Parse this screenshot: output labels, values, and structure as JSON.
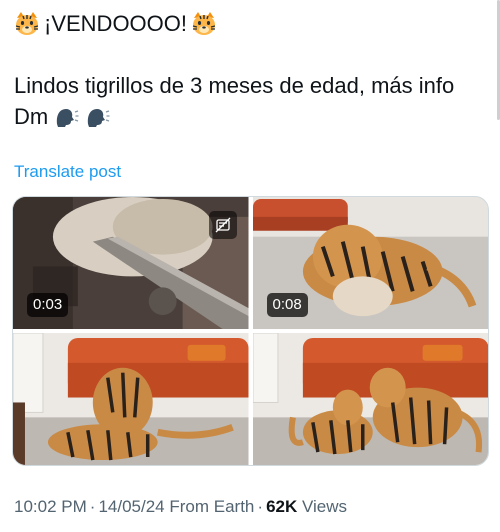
{
  "post": {
    "title_text": "¡VENDOOOO!",
    "title_icon": "tiger-face-icon",
    "body_text": "Lindos tigrillos de 3 meses de edad, más info Dm",
    "speaking_icon": "speaking-head-icon",
    "translate_label": "Translate post"
  },
  "media": [
    {
      "kind": "video",
      "duration": "0:03",
      "icon": "gif-icon"
    },
    {
      "kind": "video",
      "duration": "0:08"
    },
    {
      "kind": "image"
    },
    {
      "kind": "image"
    }
  ],
  "meta": {
    "time": "10:02 PM",
    "date": "14/05/24",
    "source": "From Earth",
    "separator": "·",
    "views_count": "62K",
    "views_label": "Views"
  },
  "colors": {
    "accent": "#1d9bf0",
    "text": "#0f1419",
    "muted": "#536471"
  }
}
